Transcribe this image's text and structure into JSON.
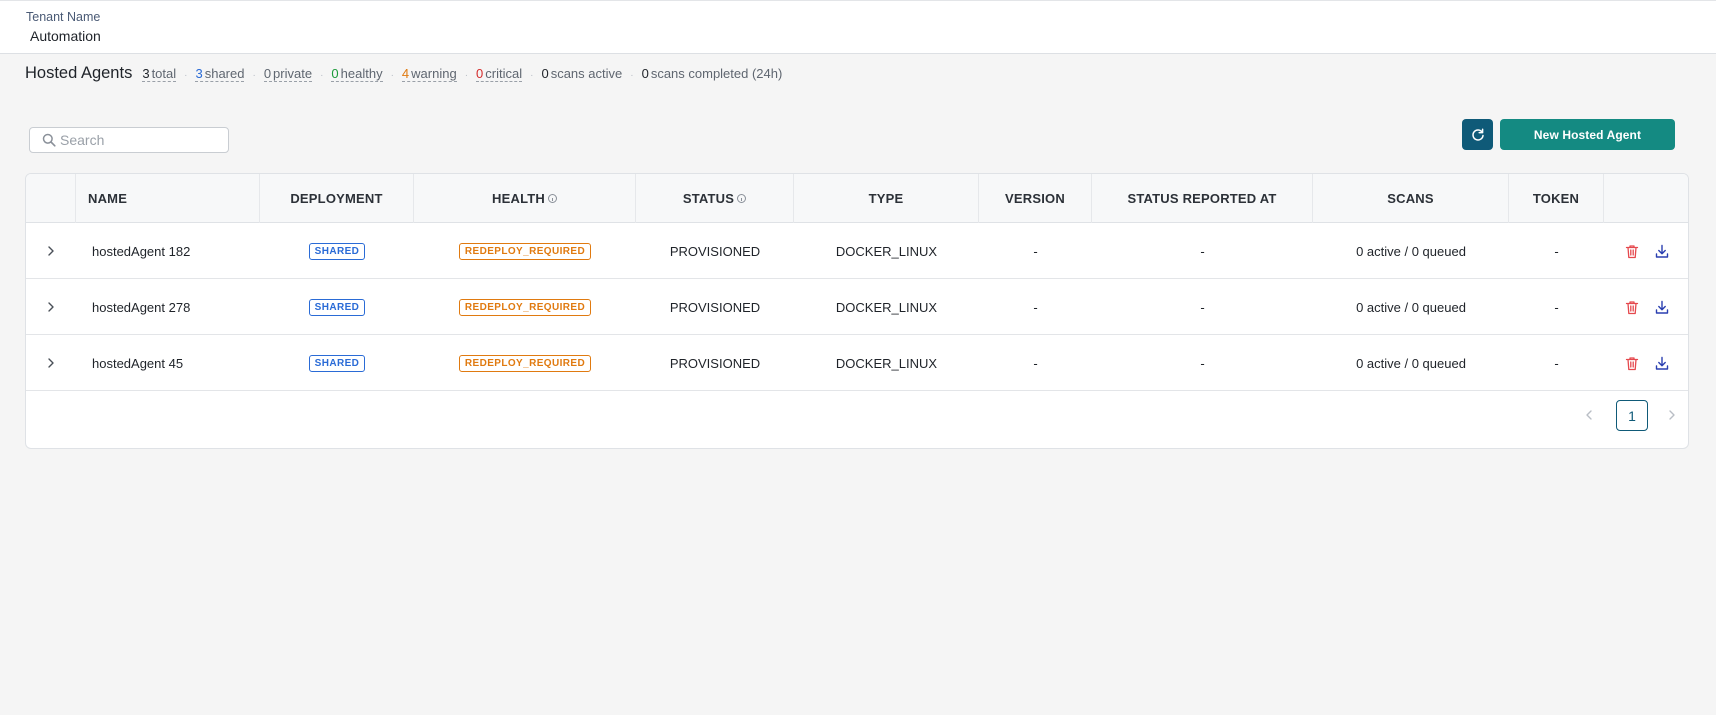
{
  "tenant": {
    "label": "Tenant Name",
    "value": "Automation"
  },
  "page": {
    "title": "Hosted Agents"
  },
  "stats": [
    {
      "num": "3",
      "label": "total",
      "color": "dark"
    },
    {
      "num": "3",
      "label": "shared",
      "color": "blue"
    },
    {
      "num": "0",
      "label": "private",
      "color": "plain"
    },
    {
      "num": "0",
      "label": "healthy",
      "color": "green"
    },
    {
      "num": "4",
      "label": "warning",
      "color": "orange"
    },
    {
      "num": "0",
      "label": "critical",
      "color": "red"
    },
    {
      "num": "0",
      "label": "scans active",
      "color": "dark"
    },
    {
      "num": "0",
      "label": "scans completed (24h)",
      "color": "dark"
    }
  ],
  "stat_separator": "·",
  "search": {
    "placeholder": "Search",
    "value": ""
  },
  "toolbar": {
    "new_label": "New Hosted Agent"
  },
  "table": {
    "columns": [
      "NAME",
      "DEPLOYMENT",
      "HEALTH",
      "STATUS",
      "TYPE",
      "VERSION",
      "STATUS REPORTED AT",
      "SCANS",
      "TOKEN"
    ],
    "rows": [
      {
        "name": "hostedAgent 182",
        "deployment": "SHARED",
        "health": "REDEPLOY_REQUIRED",
        "status": "PROVISIONED",
        "type": "DOCKER_LINUX",
        "version": "-",
        "reported": "-",
        "scans": "0 active / 0 queued",
        "token": "-"
      },
      {
        "name": "hostedAgent 278",
        "deployment": "SHARED",
        "health": "REDEPLOY_REQUIRED",
        "status": "PROVISIONED",
        "type": "DOCKER_LINUX",
        "version": "-",
        "reported": "-",
        "scans": "0 active / 0 queued",
        "token": "-"
      },
      {
        "name": "hostedAgent 45",
        "deployment": "SHARED",
        "health": "REDEPLOY_REQUIRED",
        "status": "PROVISIONED",
        "type": "DOCKER_LINUX",
        "version": "-",
        "reported": "-",
        "scans": "0 active / 0 queued",
        "token": "-"
      }
    ]
  },
  "pagination": {
    "current": "1"
  },
  "colors": {
    "primary": "#148a82",
    "refresh": "#0f5a78",
    "shared": "#2a6bd6",
    "warning": "#e07a10",
    "danger": "#e5484d",
    "download": "#2a3fb0"
  },
  "icons": {
    "search": "search-icon",
    "refresh": "refresh-icon",
    "expand": "chevron-right-icon",
    "delete": "trash-icon",
    "download": "download-icon",
    "info": "info-icon"
  }
}
